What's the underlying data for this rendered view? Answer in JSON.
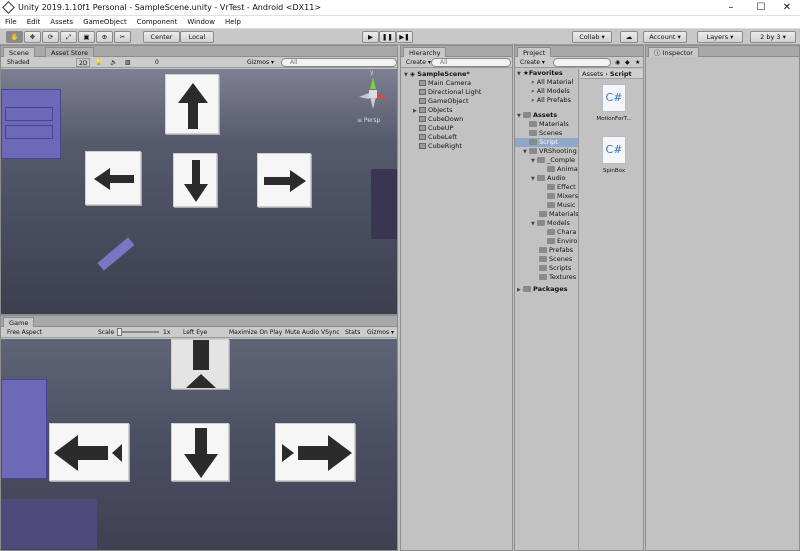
{
  "window": {
    "title": "Unity 2019.1.10f1 Personal - SampleScene.unity - VrTest - Android <DX11>",
    "min": "–",
    "max": "☐",
    "close": "✕"
  },
  "menu": [
    "File",
    "Edit",
    "Assets",
    "GameObject",
    "Component",
    "Window",
    "Help"
  ],
  "toolbar": {
    "center": "Center",
    "local": "Local",
    "collab": "Collab ▾",
    "cloud": "☁",
    "account": "Account ▾",
    "layers": "Layers ▾",
    "layout": "2 by 3 ▾",
    "play": "▶",
    "pause": "❚❚",
    "step": "▶❚"
  },
  "scene": {
    "tab": "Scene",
    "asset_tab": "Asset Store",
    "shading": "Shaded",
    "mode2d": "2D",
    "gizmos": "Gizmos ▾",
    "search": "All",
    "persp": "≡ Persp",
    "fx_count": "0",
    "axis_y": "y"
  },
  "game": {
    "tab": "Game",
    "aspect": "Free Aspect",
    "scale_label": "Scale",
    "scale_value": "1x",
    "eye": "Left Eye",
    "maximize": "Maximize On Play",
    "mute": "Mute Audio",
    "vsync": "VSync",
    "stats": "Stats",
    "gizmos": "Gizmos ▾"
  },
  "hierarchy": {
    "tab": "Hierarchy",
    "create": "Create ▾",
    "search": "All",
    "scene": "SampleScene*",
    "items": [
      "Main Camera",
      "Directional Light",
      "GameObject",
      "Objects",
      "CubeDown",
      "CubeUP",
      "CubeLeft",
      "CubeRight"
    ]
  },
  "project": {
    "tab": "Project",
    "create": "Create ▾",
    "search": "",
    "favorites": "Favorites",
    "fav_items": [
      "All Material",
      "All Models",
      "All Prefabs"
    ],
    "assets": "Assets",
    "tree": [
      "Materials",
      "Scenes",
      "Script",
      "VRShooting",
      "_Comple",
      "Anima",
      "Audio",
      "Effect",
      "Mixers",
      "Music",
      "Materials",
      "Models",
      "Chara",
      "Enviro",
      "Prefabs",
      "Scenes",
      "Scripts",
      "Textures"
    ],
    "packages": "Packages",
    "breadcrumb_root": "Assets",
    "breadcrumb_sep": "›",
    "breadcrumb_leaf": "Script",
    "files": [
      {
        "name": "MotionForT...",
        "icon": "C#"
      },
      {
        "name": "SpinBox",
        "icon": "C#"
      }
    ]
  },
  "inspector": {
    "tab": "Inspector"
  },
  "colors": {
    "sky": "#5f6577",
    "floor": "#3d4152",
    "cube": "#f6f6f6",
    "arrow": "#2b2b2b",
    "dresser": "#6e68b8",
    "selection": "#8fa8c8"
  }
}
